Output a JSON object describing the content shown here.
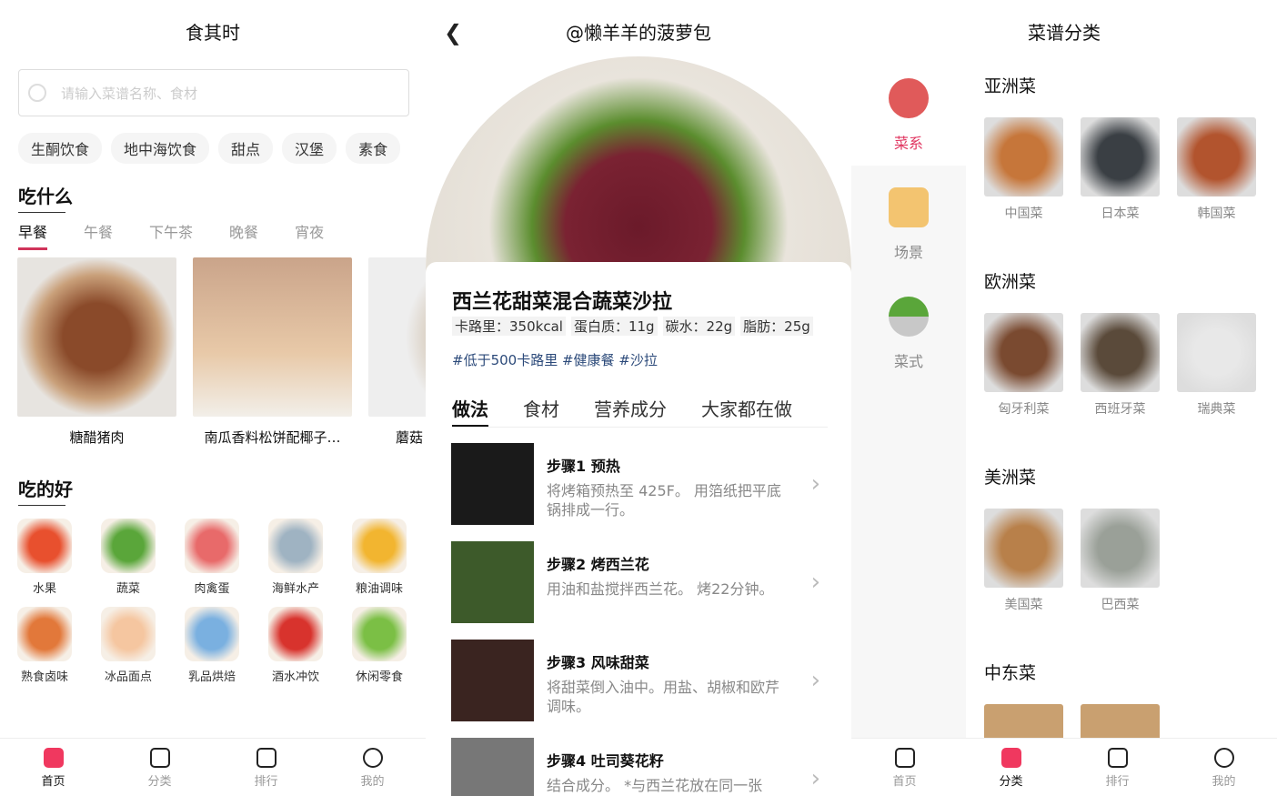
{
  "home": {
    "title": "食其时",
    "search_placeholder": "请输入菜谱名称、食材",
    "chips": [
      "生酮饮食",
      "地中海饮食",
      "甜点",
      "汉堡",
      "素食"
    ],
    "section1": "吃什么",
    "meal_tabs": [
      "早餐",
      "午餐",
      "下午茶",
      "晚餐",
      "宵夜"
    ],
    "cards": [
      "糖醋猪肉",
      "南瓜香料松饼配椰子…",
      "蘑菇"
    ],
    "section2": "吃的好",
    "grid": [
      {
        "label": "水果",
        "color": "#e8502e"
      },
      {
        "label": "蔬菜",
        "color": "#5aa63a"
      },
      {
        "label": "肉禽蛋",
        "color": "#e86a6a"
      },
      {
        "label": "海鲜水产",
        "color": "#9fb3c2"
      },
      {
        "label": "粮油调味",
        "color": "#f2b530"
      },
      {
        "label": "熟食卤味",
        "color": "#e2783a"
      },
      {
        "label": "冰品面点",
        "color": "#f5c6a0"
      },
      {
        "label": "乳品烘焙",
        "color": "#7ab0e0"
      },
      {
        "label": "酒水冲饮",
        "color": "#d8332d"
      },
      {
        "label": "休闲零食",
        "color": "#7bbf45"
      }
    ],
    "nav": [
      "首页",
      "分类",
      "排行",
      "我的"
    ]
  },
  "recipe": {
    "author": "@懒羊羊的菠萝包",
    "title": "西兰花甜菜混合蔬菜沙拉",
    "nutrition": [
      "卡路里：350kcal",
      "蛋白质：11g",
      "碳水：22g",
      "脂肪：25g"
    ],
    "tags": "#低于500卡路里 #健康餐 #沙拉",
    "tabs": [
      "做法",
      "食材",
      "营养成分",
      "大家都在做"
    ],
    "steps": [
      {
        "title": "步骤1 预热",
        "desc": "将烤箱预热至 425F。 用箔纸把平底锅排成一行。"
      },
      {
        "title": "步骤2 烤西兰花",
        "desc": "用油和盐搅拌西兰花。 烤22分钟。"
      },
      {
        "title": "步骤3 风味甜菜",
        "desc": "将甜菜倒入油中。用盐、胡椒和欧芹调味。"
      },
      {
        "title": "步骤4 吐司葵花籽",
        "desc": "结合成分。 *与西兰花放在同一张"
      }
    ]
  },
  "category": {
    "title": "菜谱分类",
    "side": [
      "菜系",
      "场景",
      "菜式"
    ],
    "groups": [
      {
        "name": "亚洲菜",
        "items": [
          "中国菜",
          "日本菜",
          "韩国菜"
        ]
      },
      {
        "name": "欧洲菜",
        "items": [
          "匈牙利菜",
          "西班牙菜",
          "瑞典菜"
        ]
      },
      {
        "name": "美洲菜",
        "items": [
          "美国菜",
          "巴西菜"
        ]
      },
      {
        "name": "中东菜",
        "items": []
      }
    ],
    "nav": [
      "首页",
      "分类",
      "排行",
      "我的"
    ]
  },
  "accent": "#f0385f"
}
